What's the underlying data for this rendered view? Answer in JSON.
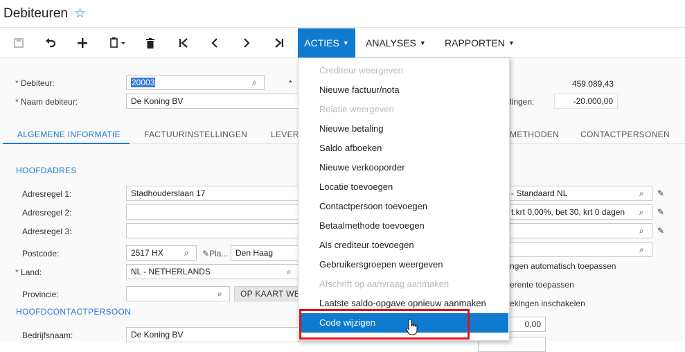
{
  "header": {
    "title": "Debiteuren",
    "star_icon": "star-outline-icon"
  },
  "toolbar": {
    "icons": [
      "save-icon",
      "undo-icon",
      "add-icon",
      "clipboard-icon",
      "delete-icon",
      "first-icon",
      "previous-icon",
      "next-icon",
      "last-icon"
    ],
    "acties_label": "ACTIES",
    "analyses_label": "ANALYSES",
    "rapporten_label": "RAPPORTEN"
  },
  "form": {
    "debiteur_label": "Debiteur:",
    "debiteur_value": "20003",
    "naam_label": "Naam debiteur:",
    "naam_value": "De Koning BV",
    "saldo_value": "459.089,43",
    "right_label2": "lingen:",
    "right_value2": "-20.000,00"
  },
  "tabs": [
    "ALGEMENE INFORMATIE",
    "FACTUURINSTELLINGEN",
    "LEVER",
    "METHODEN",
    "CONTACTPERSONEN"
  ],
  "address": {
    "section_title": "HOOFDADRES",
    "adresregel1_label": "Adresregel 1:",
    "adresregel1_value": "Stadhouderslaan 17",
    "adresregel2_label": "Adresregel 2:",
    "adresregel3_label": "Adresregel 3:",
    "postcode_label": "Postcode:",
    "postcode_value": "2517 HX",
    "plaats_short": "Pla...",
    "plaats_value": "Den Haag",
    "land_label": "Land:",
    "land_value": "NL - NETHERLANDS",
    "provincie_label": "Provincie:",
    "kaart_button": "OP KAART WE"
  },
  "contact": {
    "section_title": "HOOFDCONTACTPERSOON",
    "bedrijfsnaam_label": "Bedrijfsnaam:",
    "bedrijfsnaam_value": "De Koning BV"
  },
  "right_panel": {
    "field1_value": "- Standaard NL",
    "field2_value": "t.krt 0,00%, bet 30, krt 0 dagen",
    "check1": "ngen automatisch toepassen",
    "check2": "erente toepassen",
    "check3": "ekingen inschakelen",
    "amount_value": "0,00"
  },
  "acties_menu": {
    "items": [
      {
        "label": "Crediteur weergeven",
        "enabled": false
      },
      {
        "label": "Nieuwe factuur/nota",
        "enabled": true
      },
      {
        "label": "Relatie weergeven",
        "enabled": false
      },
      {
        "label": "Nieuwe betaling",
        "enabled": true
      },
      {
        "label": "Saldo afboeken",
        "enabled": true
      },
      {
        "label": "Nieuwe verkooporder",
        "enabled": true
      },
      {
        "label": "Locatie toevoegen",
        "enabled": true
      },
      {
        "label": "Contactpersoon toevoegen",
        "enabled": true
      },
      {
        "label": "Betaalmethode toevoegen",
        "enabled": true
      },
      {
        "label": "Als crediteur toevoegen",
        "enabled": true
      },
      {
        "label": "Gebruikersgroepen weergeven",
        "enabled": true
      },
      {
        "label": "Afschrift op aanvraag aanmaken",
        "enabled": false
      },
      {
        "label": "Laatste saldo-opgave opnieuw aanmaken",
        "enabled": true
      },
      {
        "label": "Code wijzigen",
        "enabled": true,
        "highlighted": true
      }
    ]
  },
  "colors": {
    "accent": "#1c7ad8",
    "menu_active": "#0f7bd0",
    "highlight_box": "#e0121a"
  }
}
